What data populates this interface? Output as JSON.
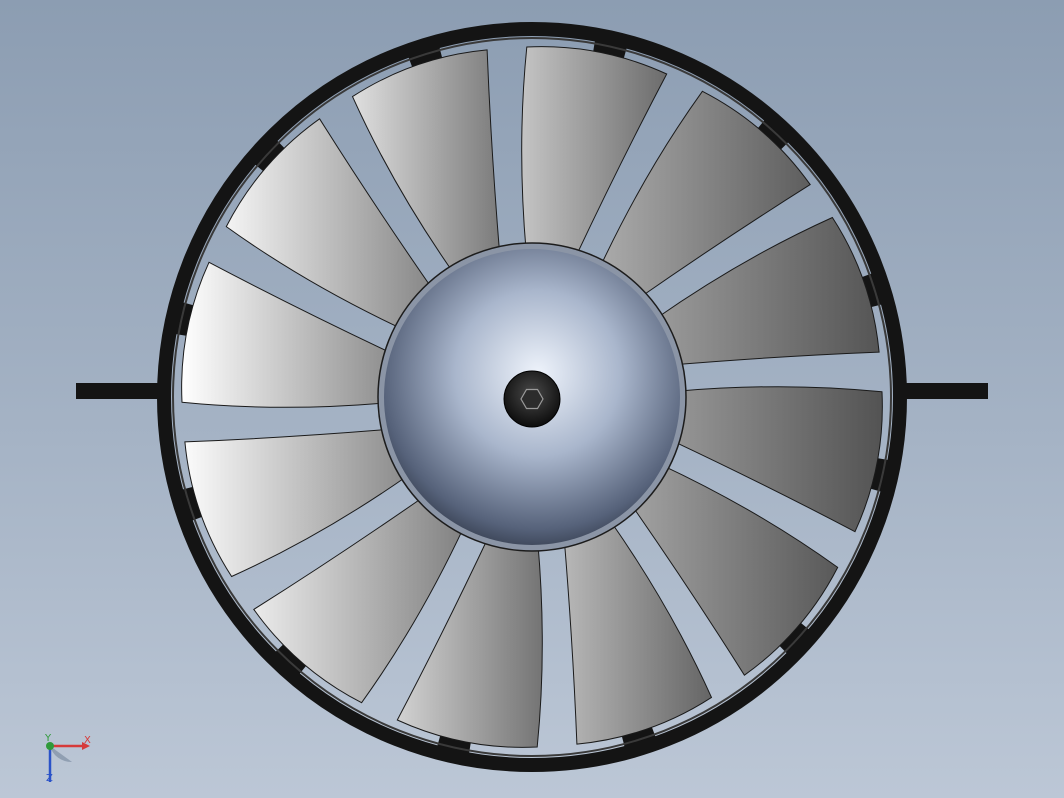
{
  "viewport": {
    "background_top": "#8c9db2",
    "background_bottom": "#bcc7d6"
  },
  "model": {
    "blade_count": 12,
    "stator_count": 12,
    "hub_fastener": "hex-socket-icon",
    "colors": {
      "shroud": "#141414",
      "blade_light": "#ffffff",
      "blade_dark": "#5a5a5a",
      "hub_center": "#dfe6f2",
      "hub_edge": "#3a4356"
    }
  },
  "triad": {
    "x_label": "X",
    "y_label": "Y",
    "z_label": "Z",
    "x_color": "#d63a3a",
    "y_color": "#2f9a3a",
    "z_color": "#2a52c8"
  }
}
